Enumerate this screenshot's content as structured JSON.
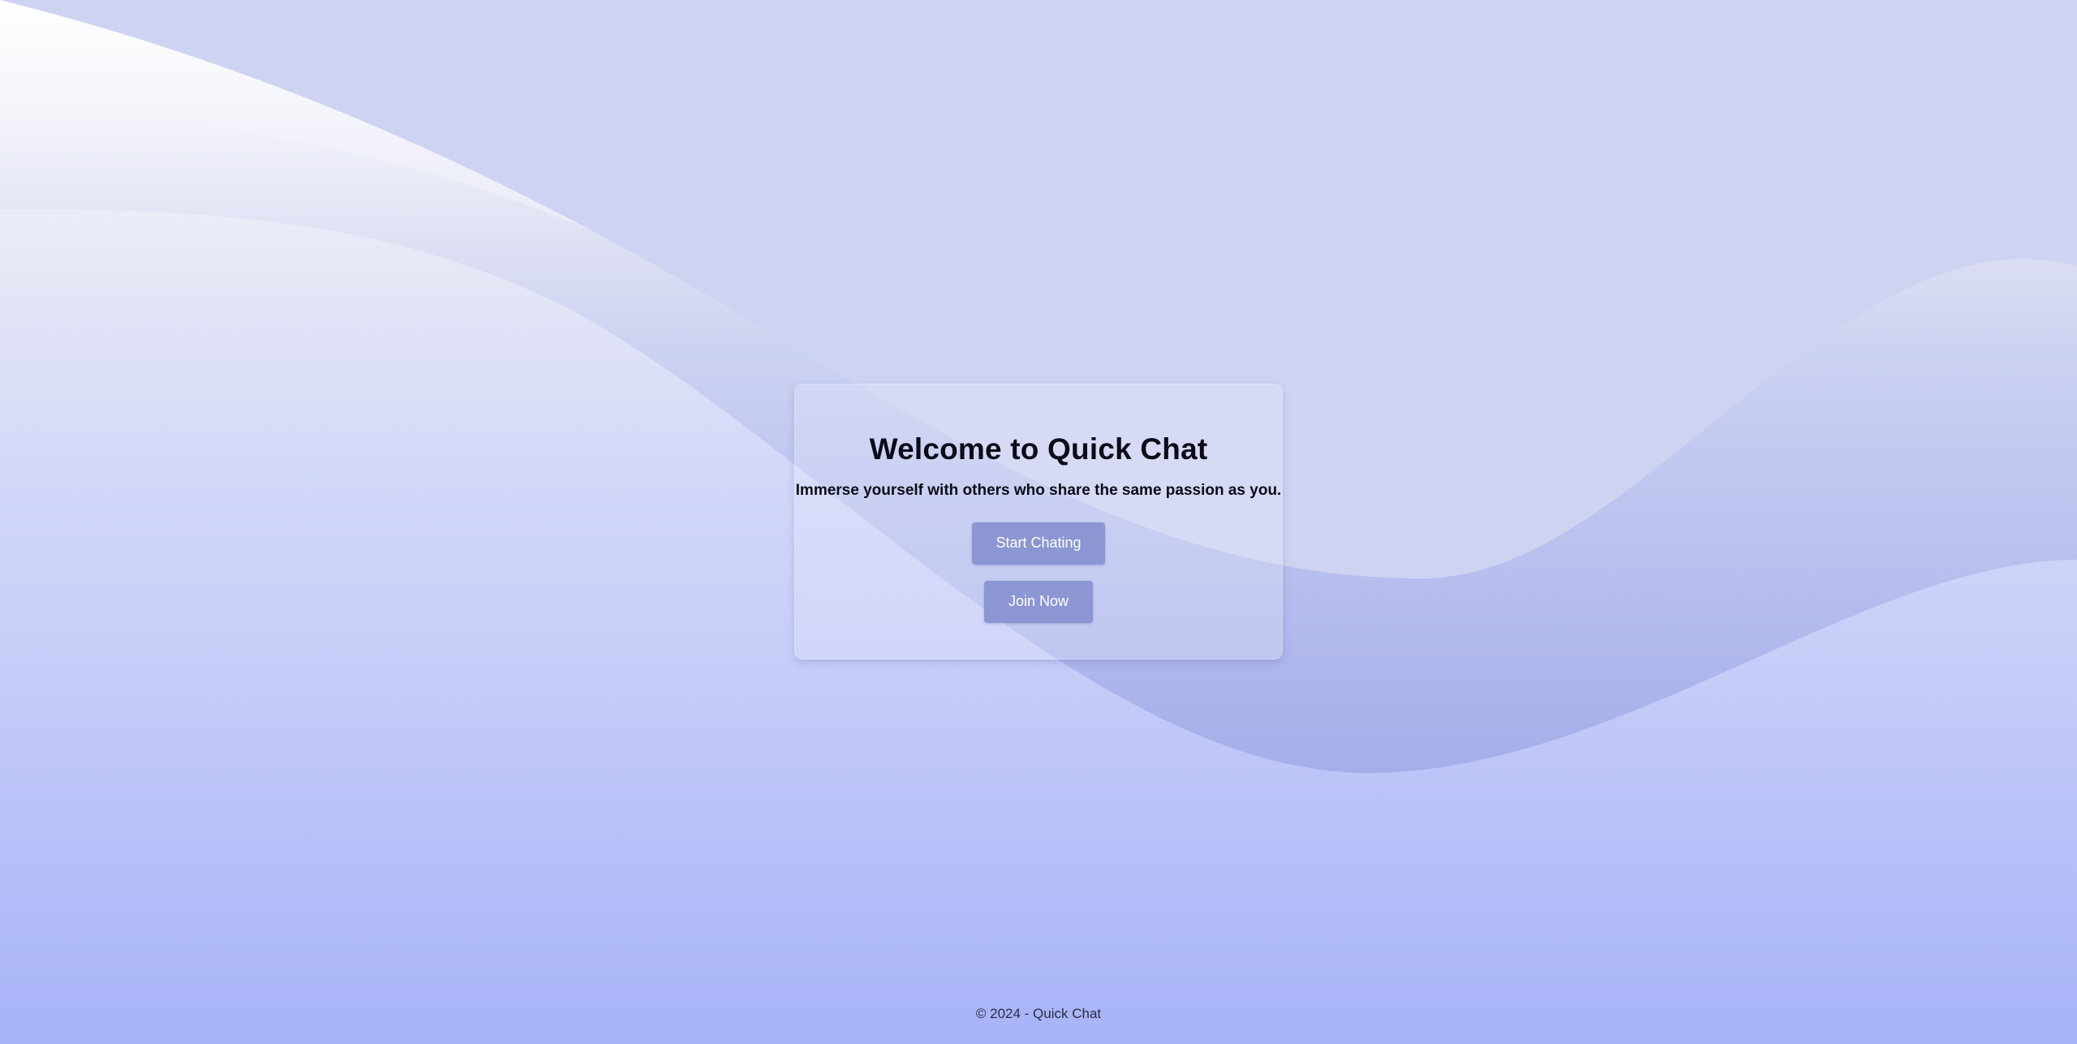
{
  "card": {
    "title": "Welcome to Quick Chat",
    "subtitle": "Immerse yourself with others who share the same passion as you.",
    "start_button": "Start Chating",
    "join_button": "Join Now"
  },
  "footer": {
    "text": "© 2024 - Quick Chat"
  },
  "colors": {
    "button_bg": "#8b96d3",
    "wave_fill": "#cfd3f2",
    "background_top": "#ffffff",
    "background_bottom": "#a8b3f8"
  }
}
